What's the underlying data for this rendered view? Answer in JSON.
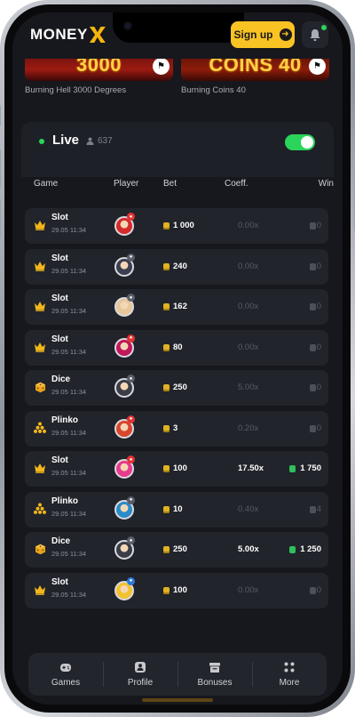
{
  "header": {
    "logo_text": "MONEY",
    "signup_label": "Sign up",
    "accent": "#f8c323"
  },
  "games": [
    {
      "banner": "3000",
      "name": "Burning Hell 3000 Degrees"
    },
    {
      "banner": "COINS 40",
      "name": "Burning Coins 40"
    }
  ],
  "live": {
    "title": "Live",
    "count": "637",
    "toggle_on": true,
    "columns": [
      "Game",
      "Player",
      "Bet",
      "Coeff.",
      "Win"
    ],
    "rows": [
      {
        "game": "Slot",
        "time": "29.05 11:34",
        "icon": "crown-icon",
        "avatar_color": "#d52a2a",
        "badge_color": "#e33333",
        "bet": "1 000",
        "coeff": "0.00x",
        "win": "0",
        "hit": false
      },
      {
        "game": "Slot",
        "time": "29.05 11:34",
        "icon": "crown-icon",
        "avatar_color": "#3a3f52",
        "badge_color": "#5a5e68",
        "bet": "240",
        "coeff": "0.00x",
        "win": "0",
        "hit": false
      },
      {
        "game": "Slot",
        "time": "29.05 11:34",
        "icon": "crown-icon",
        "avatar_color": "#e7c79a",
        "badge_color": "#5a5e68",
        "bet": "162",
        "coeff": "0.00x",
        "win": "0",
        "hit": false
      },
      {
        "game": "Slot",
        "time": "29.05 11:34",
        "icon": "crown-icon",
        "avatar_color": "#c0185a",
        "badge_color": "#e33333",
        "bet": "80",
        "coeff": "0.00x",
        "win": "0",
        "hit": false
      },
      {
        "game": "Dice",
        "time": "29.05 11:34",
        "icon": "dice-icon",
        "avatar_color": "#3a3d48",
        "badge_color": "#5a5e68",
        "bet": "250",
        "coeff": "5.00x",
        "win": "0",
        "hit": false
      },
      {
        "game": "Plinko",
        "time": "29.05 11:34",
        "icon": "plinko-icon",
        "avatar_color": "#d9462b",
        "badge_color": "#e33333",
        "bet": "3",
        "coeff": "0.20x",
        "win": "0",
        "hit": false
      },
      {
        "game": "Slot",
        "time": "29.05 11:34",
        "icon": "crown-icon",
        "avatar_color": "#e83b8c",
        "badge_color": "#e33333",
        "bet": "100",
        "coeff": "17.50x",
        "win": "1 750",
        "hit": true
      },
      {
        "game": "Plinko",
        "time": "29.05 11:34",
        "icon": "plinko-icon",
        "avatar_color": "#2a8bc9",
        "badge_color": "#5a5e68",
        "bet": "10",
        "coeff": "0.40x",
        "win": "4",
        "hit": false
      },
      {
        "game": "Dice",
        "time": "29.05 11:34",
        "icon": "dice-icon",
        "avatar_color": "#3a3d48",
        "badge_color": "#5a5e68",
        "bet": "250",
        "coeff": "5.00x",
        "win": "1 250",
        "hit": true
      },
      {
        "game": "Slot",
        "time": "29.05 11:34",
        "icon": "crown-icon",
        "avatar_color": "#f2c230",
        "badge_color": "#2a7be0",
        "bet": "100",
        "coeff": "0.00x",
        "win": "0",
        "hit": false
      }
    ]
  },
  "nav": [
    {
      "label": "Games",
      "icon": "gamepad-icon"
    },
    {
      "label": "Profile",
      "icon": "profile-icon"
    },
    {
      "label": "Bonuses",
      "icon": "gift-icon"
    },
    {
      "label": "More",
      "icon": "grid-icon"
    }
  ]
}
